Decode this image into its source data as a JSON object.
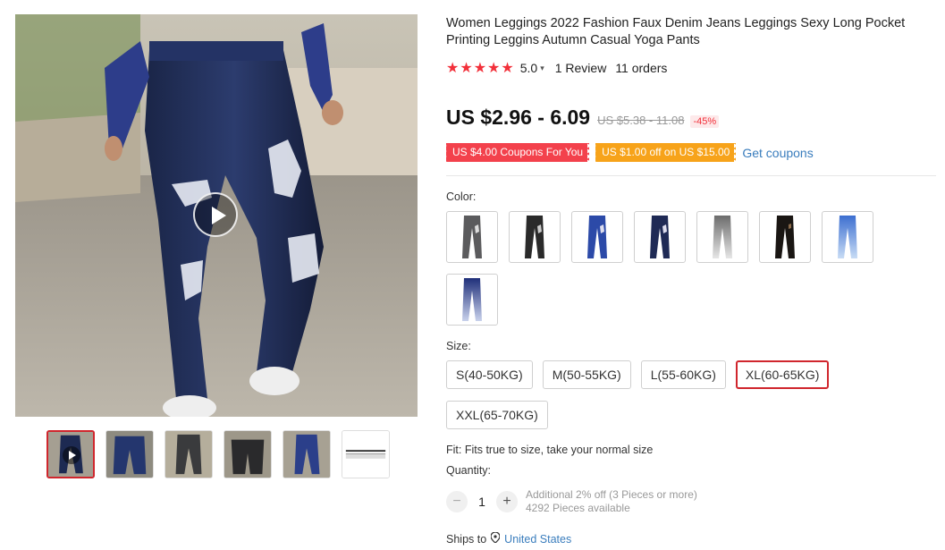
{
  "product": {
    "title": "Women Leggings 2022 Fashion Faux Denim Jeans Leggings Sexy Long Pocket Printing Leggins Autumn Casual Yoga Pants",
    "rating": "5.0",
    "stars": "★★★★★",
    "reviews": "1 Review",
    "orders": "11 orders"
  },
  "price": {
    "current": "US $2.96 - 6.09",
    "original": "US $5.38 - 11.08",
    "discount": "-45%"
  },
  "coupons": {
    "store": "US $4.00 Coupons For You",
    "select": "US $1.00 off on US $15.00",
    "get": "Get coupons"
  },
  "color": {
    "label": "Color:",
    "options": [
      "grey-distressed",
      "black-distressed",
      "blue-distressed",
      "navy-distressed",
      "light-grey-fade",
      "black-solid",
      "light-blue-fade",
      "navy-fade"
    ]
  },
  "size": {
    "label": "Size:",
    "options": [
      "S(40-50KG)",
      "M(50-55KG)",
      "L(55-60KG)",
      "XL(60-65KG)",
      "XXL(65-70KG)"
    ],
    "selected": "XL(60-65KG)"
  },
  "fit": "Fit: Fits true to size, take your normal size",
  "quantity": {
    "label": "Quantity:",
    "value": "1",
    "minus": "−",
    "plus": "+",
    "promo": "Additional 2% off (3 Pieces or more)",
    "available": "4292 Pieces available"
  },
  "shipping": {
    "label": "Ships to",
    "country": "United States"
  },
  "colors": {
    "accent_red": "#f2303a",
    "coupon_red": "#f3414c",
    "coupon_orange": "#f7a31a",
    "link_blue": "#3a7dbd",
    "selected_border": "#d0262d"
  }
}
